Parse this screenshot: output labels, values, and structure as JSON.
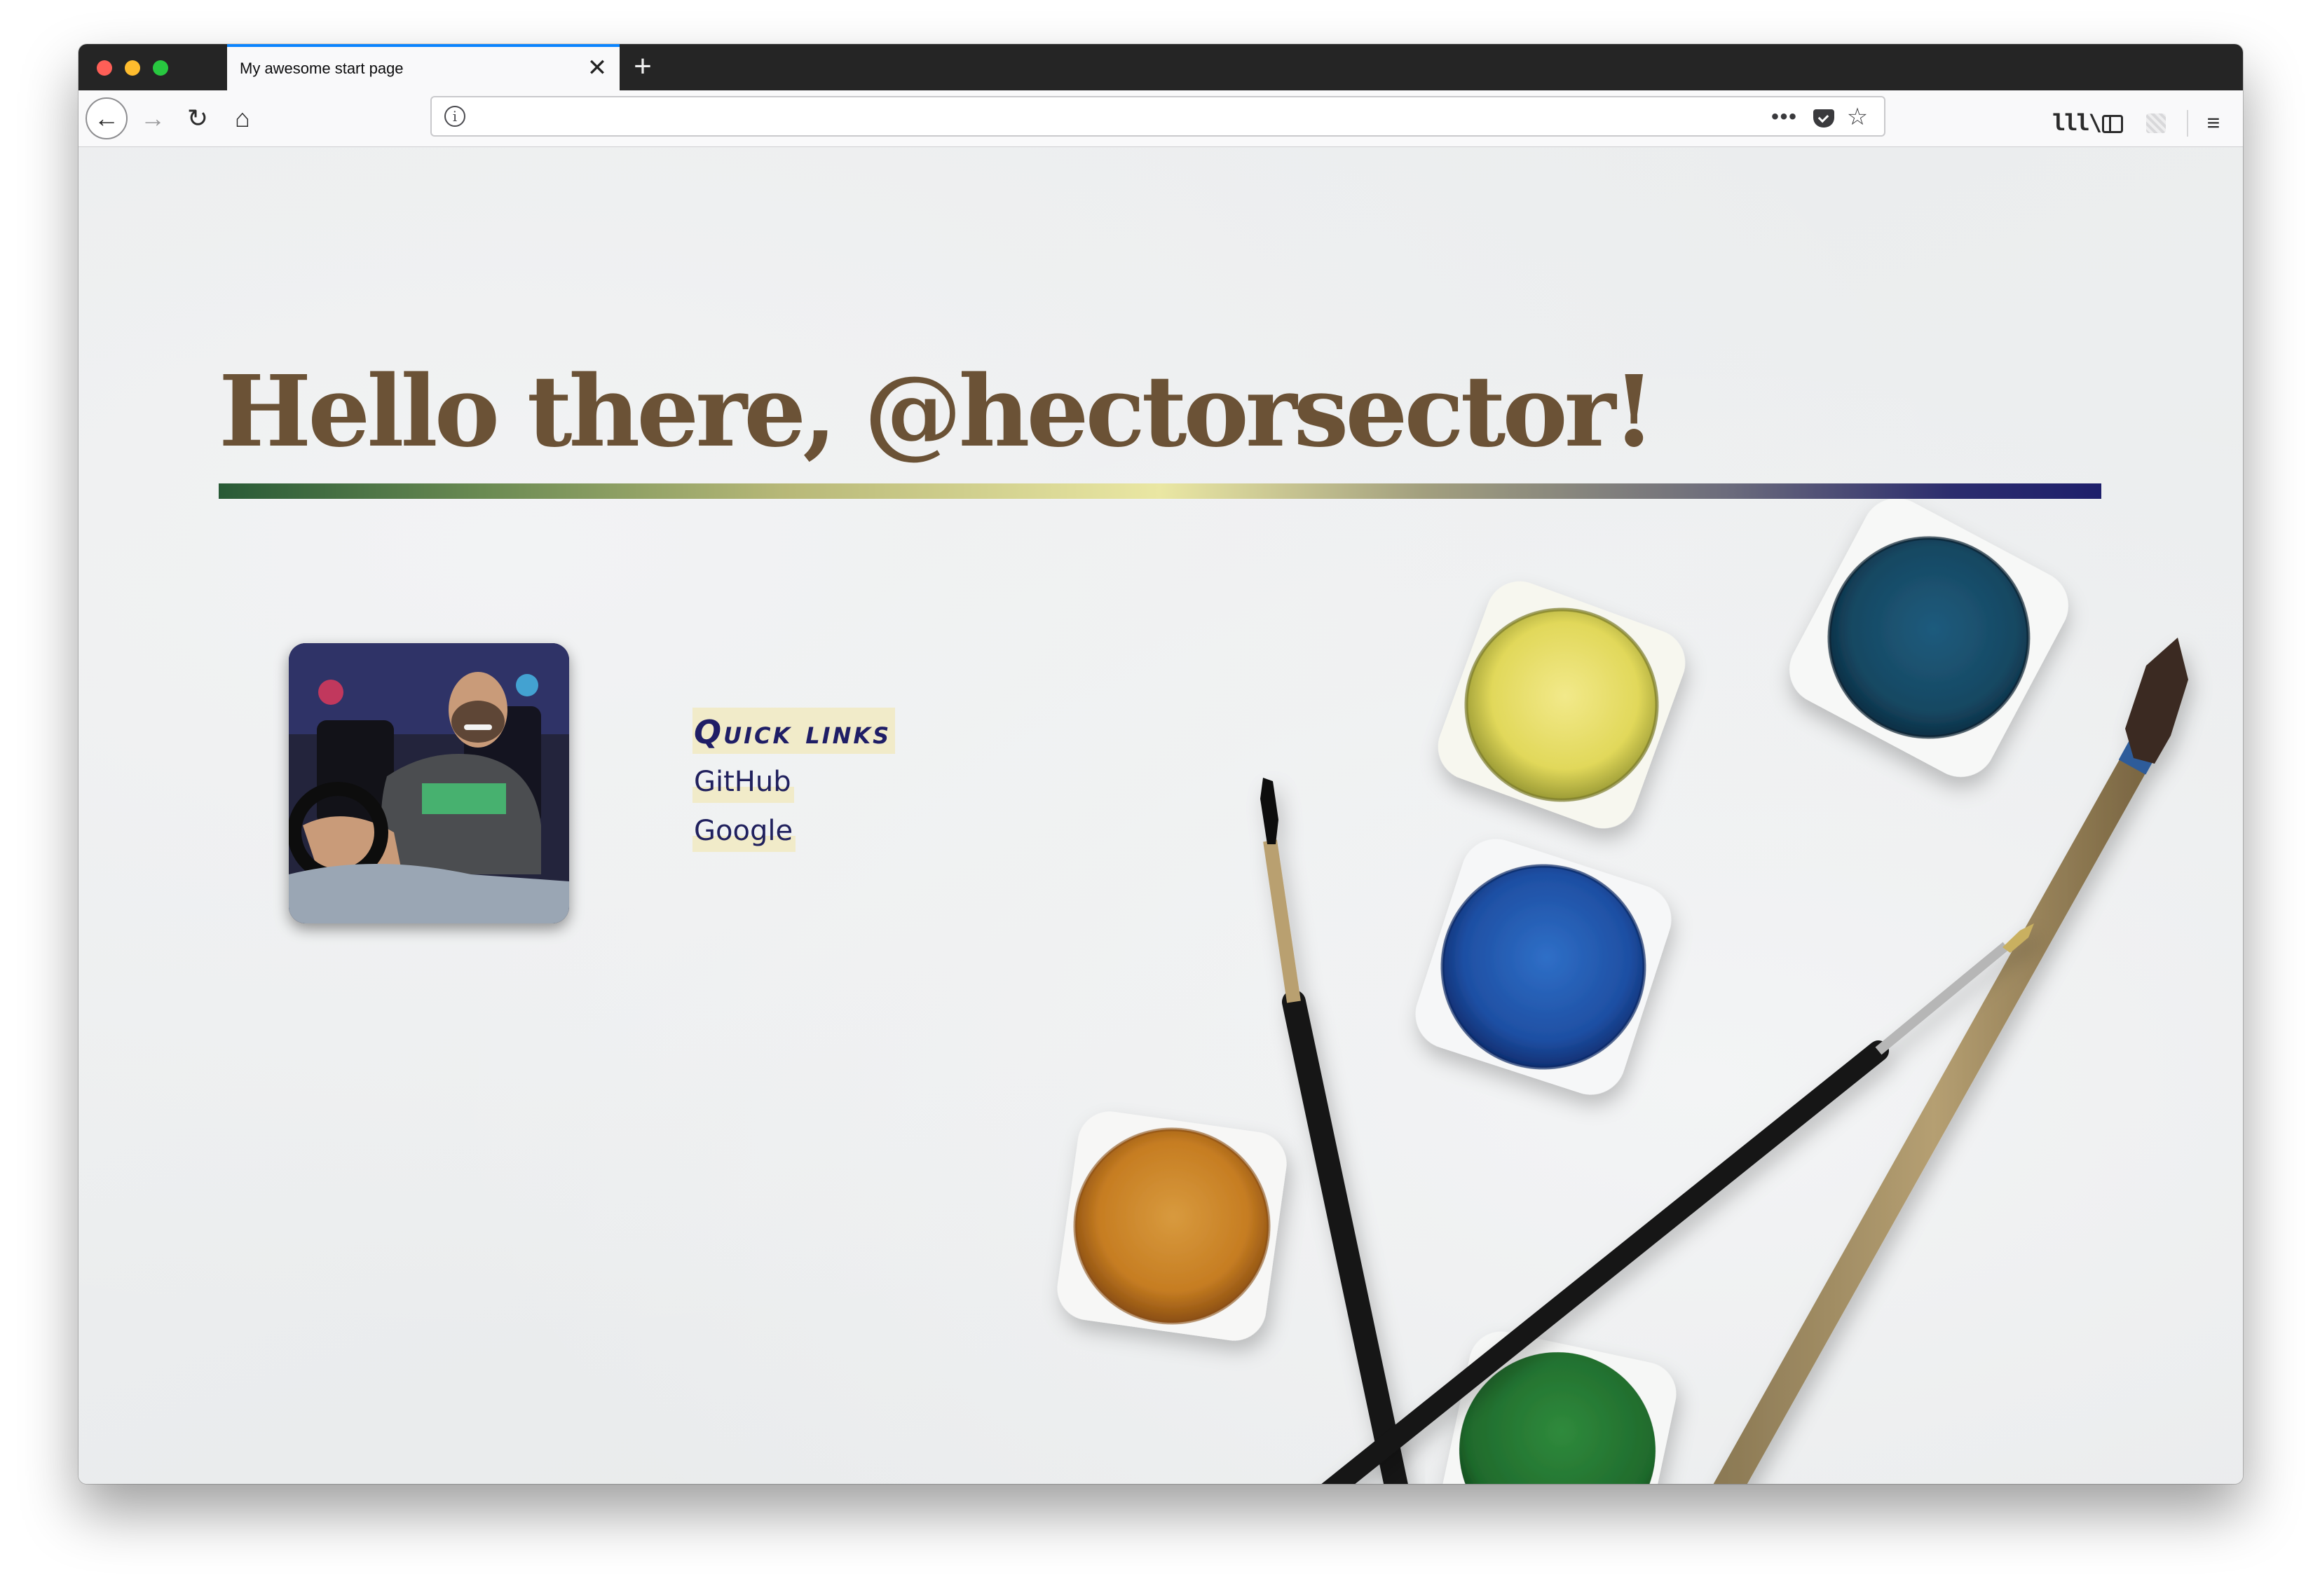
{
  "browser": {
    "tab_title": "My awesome start page",
    "tab_close_glyph": "✕",
    "new_tab_glyph": "+",
    "url": "",
    "icons": {
      "back": "←",
      "forward": "→",
      "reload": "↻",
      "home": "⌂",
      "info": "i",
      "more": "•••",
      "star": "☆",
      "library": "lll\\",
      "menu": "≡"
    }
  },
  "page": {
    "greeting": "Hello there, @hectorsector!",
    "quick_links": {
      "heading": "Quick links",
      "links": [
        {
          "label": "GitHub"
        },
        {
          "label": "Google"
        }
      ]
    }
  },
  "colors": {
    "headline": "#6b5236",
    "link_text": "#20205d",
    "link_highlight": "#f1ebc9",
    "tab_accent": "#0a84ff"
  }
}
